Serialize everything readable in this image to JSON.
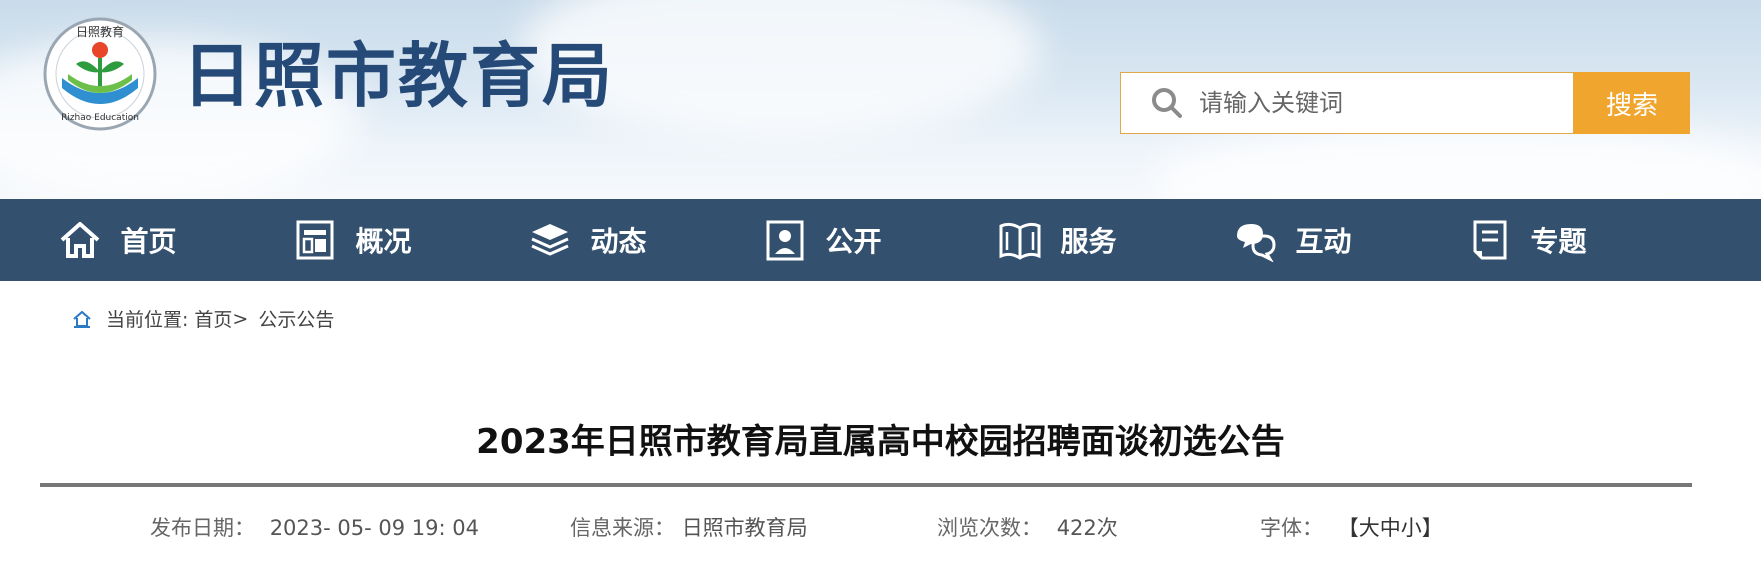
{
  "site": {
    "title": "日照市教育局",
    "logo_text": "日照教育",
    "logo_en": "Rizhao Education"
  },
  "search": {
    "placeholder": "请输入关键词",
    "button_label": "搜索"
  },
  "nav": [
    {
      "label": "首页",
      "icon": "home-icon"
    },
    {
      "label": "概况",
      "icon": "overview-icon"
    },
    {
      "label": "动态",
      "icon": "news-stack-icon"
    },
    {
      "label": "公开",
      "icon": "disclosure-icon"
    },
    {
      "label": "服务",
      "icon": "open-book-icon"
    },
    {
      "label": "互动",
      "icon": "chat-icon"
    },
    {
      "label": "专题",
      "icon": "document-icon"
    }
  ],
  "breadcrumb": {
    "prefix": "当前位置:",
    "home": "首页",
    "separator": ">",
    "current": "公示公告"
  },
  "article": {
    "title": "2023年日照市教育局直属高中校园招聘面谈初选公告",
    "date_label": "发布日期：",
    "date_value": "2023- 05- 09 19: 04",
    "source_label": "信息来源：",
    "source_value": "日照市教育局",
    "views_label": "浏览次数：",
    "views_value": "422次",
    "font_label": "字体：",
    "font_open": "【",
    "font_large": "大",
    "font_medium": "中",
    "font_small": "小",
    "font_close": "】"
  },
  "colors": {
    "nav_bg": "#33506f",
    "title_blue": "#264a78",
    "search_button": "#f0a52e",
    "search_border": "#e0a847"
  }
}
